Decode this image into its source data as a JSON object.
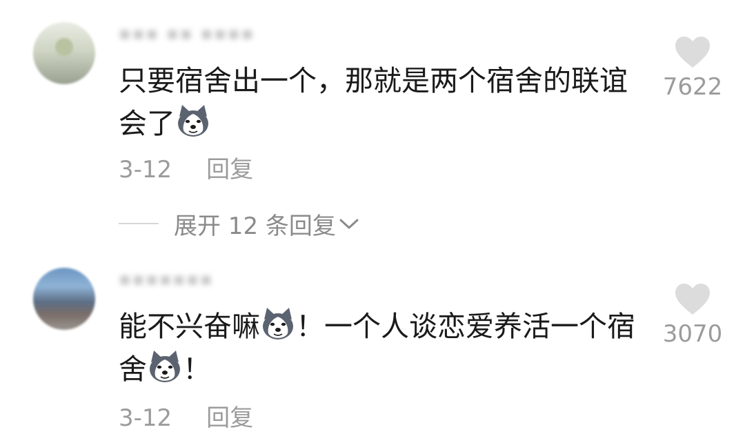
{
  "comments": [
    {
      "username": "▪▪▪ ▪▪ ▪▪▪▪",
      "text_a": "只要宿舍出一个，那就是两个宿舍的联谊会了",
      "text_b": "",
      "text_c": "",
      "date": "3-12",
      "reply_label": "回复",
      "likes": "7622"
    },
    {
      "username": "▪▪▪▪▪▪▪",
      "text_a": "能不兴奋嘛",
      "text_b": "！一个人谈恋爱养活一个宿舍",
      "text_c": "！",
      "date": "3-12",
      "reply_label": "回复",
      "likes": "3070"
    }
  ],
  "expand_replies": "展开 12 条回复",
  "icons": {
    "emoji": "husky-emoji-icon",
    "like": "heart-icon",
    "expand": "chevron-down-icon"
  },
  "colors": {
    "text": "#1a1a1a",
    "meta": "#9b9b9b",
    "heart": "#dcdcdc"
  }
}
